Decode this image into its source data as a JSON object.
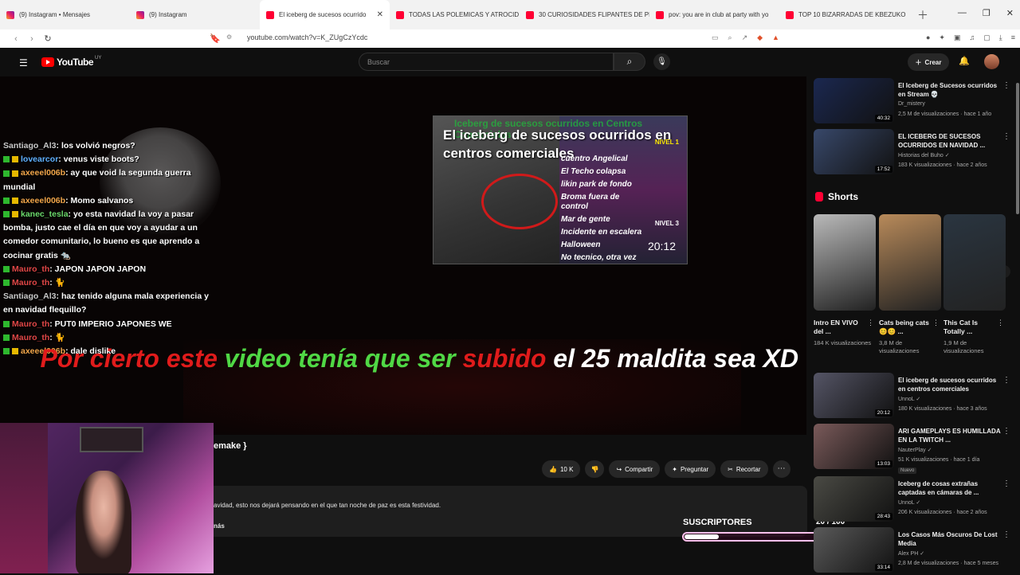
{
  "browser": {
    "tabs": [
      {
        "label": "(9) Instagram • Mensajes",
        "icon": "instagram-icon"
      },
      {
        "label": "(9) Instagram",
        "icon": "instagram-icon"
      },
      {
        "label": "El iceberg de sucesos ocurrido",
        "icon": "youtube-icon",
        "active": true
      },
      {
        "label": "TODAS LAS POLEMICAS Y ATROCID",
        "icon": "youtube-icon"
      },
      {
        "label": "30 CURIOSIDADES FLIPANTES DE PE",
        "icon": "youtube-icon"
      },
      {
        "label": "pov: you are in club at party with yo",
        "icon": "youtube-icon"
      },
      {
        "label": "TOP 10 BIZARRADAS DE KBEZUKO",
        "icon": "youtube-icon"
      }
    ],
    "url": "youtube.com/watch?v=K_ZUgCzYcdc"
  },
  "yt": {
    "logo_word": "YouTube",
    "region": "UY",
    "search_placeholder": "Buscar",
    "create_label": "Crear"
  },
  "thumbnail": {
    "header_text": "Iceberg de sucesos ocurridos en Centros Comerciales",
    "title": "El iceberg de sucesos ocurridos en centros comerciales",
    "nivel1": "NIVEL 1",
    "nivel3": "NIVEL 3",
    "lines": [
      "cuentro Angelical",
      "El Techo colapsa",
      "likin park de fondo",
      "Broma fuera de control",
      "Mar de gente",
      "Incidente en escalera",
      "Halloween",
      "No tecnico, otra vez"
    ],
    "duration": "20:12"
  },
  "chat": [
    {
      "user": "Santiago_Al3",
      "text": ": los volvió negros?",
      "color": "grey",
      "badge": ""
    },
    {
      "user": "lovearcor",
      "text": ": venus viste boots?",
      "color": "blue",
      "badge": "both"
    },
    {
      "user": "axeeel006b",
      "text": ": ay que void la segunda guerra mundial",
      "color": "yel",
      "badge": "both"
    },
    {
      "user": "axeeel006b",
      "text": ": Momo salvanos",
      "color": "yel",
      "badge": "both"
    },
    {
      "user": "kanec_tesla",
      "text": ": yo esta navidad la voy a pasar bomba, justo cae el día en que voy a ayudar a un comedor comunitario, lo bueno es que aprendo a cocinar gratis 🐀",
      "color": "green",
      "badge": "both"
    },
    {
      "user": "Mauro_th",
      "text": ": JAPON JAPON JAPON",
      "color": "red",
      "badge": "green"
    },
    {
      "user": "Mauro_th",
      "text": ": 🐈",
      "color": "red",
      "badge": "green"
    },
    {
      "user": "Santiago_Al3",
      "text": ": haz tenido alguna mala experiencia y en navidad flequillo?",
      "color": "grey",
      "badge": ""
    },
    {
      "user": "Mauro_th",
      "text": ": PUT0 IMPERIO JAPONES WE",
      "color": "red",
      "badge": "green"
    },
    {
      "user": "Mauro_th",
      "text": ": 🐈",
      "color": "red",
      "badge": "green"
    },
    {
      "user": "axeeel006b",
      "text": ": dale dislike",
      "color": "yel",
      "badge": "both"
    }
  ],
  "caption": {
    "part1": "Por cierto este",
    "part2": "video tenía que ser",
    "part3": "subido",
    "part4": "el 25 maldita sea XD"
  },
  "below": {
    "title_fragment": "emake }",
    "like_count": "10 K",
    "share_label": "Compartir",
    "ask_label": "Preguntar",
    "clip_label": "Recortar",
    "desc_text": "avidad, esto nos dejará pensando en el que tan noche de paz es esta festividad.",
    "desc_more": "nás"
  },
  "subs_widget": {
    "label": "SUSCRIPTORES",
    "count": "20 / 100",
    "progress": 0.2
  },
  "sidebar": {
    "videos_top": [
      {
        "title": "El Iceberg de Sucesos ocurridos en Stream 💀",
        "channel": "Dr_mistery",
        "meta": "2,5 M de visualizaciones · hace 1 año",
        "duration": "40:32",
        "thumb": "#1b2850"
      },
      {
        "title": "EL ICEBERG DE SUCESOS OCURRIDOS EN NAVIDAD ...",
        "channel": "Historias del Buho ✓",
        "meta": "183 K visualizaciones · hace 2 años",
        "duration": "17:52",
        "thumb": "#38486a"
      }
    ],
    "shorts_heading": "Shorts",
    "shorts": [
      {
        "title": "Intro EN VIVO del ...",
        "views": "184 K visualizaciones",
        "thumb": "#b9b9b9"
      },
      {
        "title": "Cats being cats 😊😊 ...",
        "views": "3,8 M de visualizaciones",
        "thumb": "#b88a5a"
      },
      {
        "title": "This Cat Is Totally ...",
        "views": "1,9 M de visualizaciones",
        "thumb": "#2a3540"
      }
    ],
    "videos_bottom": [
      {
        "title": "El iceberg de sucesos ocurridos en centros comerciales",
        "channel": "UnnoL ✓",
        "meta": "180 K visualizaciones · hace 3 años",
        "duration": "20:12",
        "thumb": "#555566",
        "nuevo": ""
      },
      {
        "title": "ARI GAMEPLAYS ES HUMILLADA EN LA TWITCH ...",
        "channel": "NauterPlay ✓",
        "meta": "51 K visualizaciones · hace 1 día",
        "duration": "13:03",
        "thumb": "#7a5a5a",
        "nuevo": "Nuevo"
      },
      {
        "title": "Iceberg de cosas extrañas captadas en cámaras de ...",
        "channel": "UnnoL ✓",
        "meta": "206 K visualizaciones · hace 2 años",
        "duration": "28:43",
        "thumb": "#4a4a44",
        "nuevo": ""
      },
      {
        "title": "Los Casos Más Oscuros De Lost Media",
        "channel": "Alex PH ✓",
        "meta": "2,8 M de visualizaciones · hace 5 meses",
        "duration": "33:14",
        "thumb": "#5a5a5a",
        "nuevo": ""
      }
    ]
  }
}
